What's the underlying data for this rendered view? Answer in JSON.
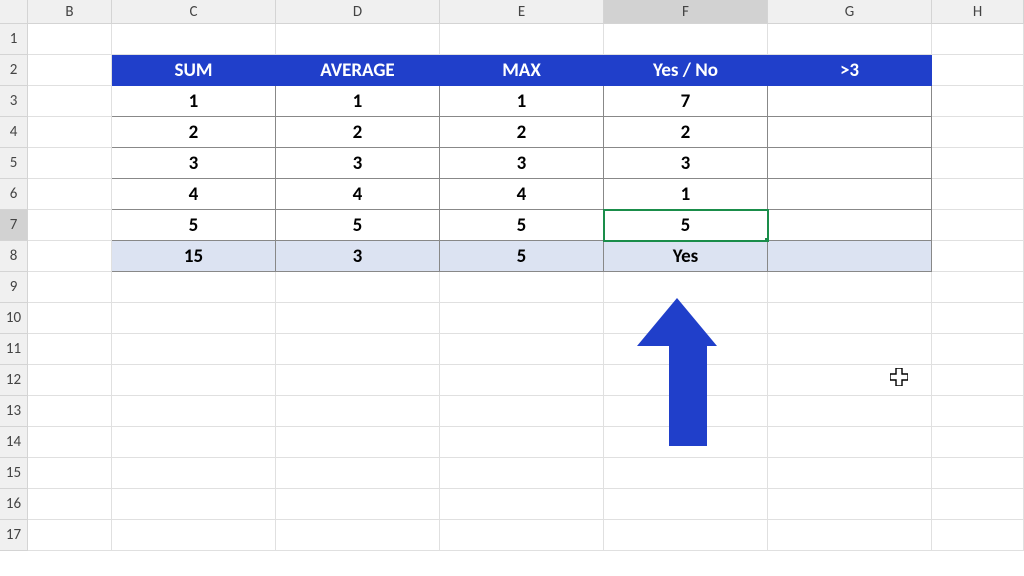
{
  "columns": [
    "B",
    "C",
    "D",
    "E",
    "F",
    "G",
    "H"
  ],
  "rows": [
    "1",
    "2",
    "3",
    "4",
    "5",
    "6",
    "7",
    "8",
    "9",
    "10",
    "11",
    "12",
    "13",
    "14",
    "15",
    "16",
    "17"
  ],
  "selected_col": "F",
  "selected_row": "7",
  "table": {
    "headers": {
      "c": "SUM",
      "d": "AVERAGE",
      "e": "MAX",
      "f": "Yes / No",
      "g": ">3"
    },
    "data": [
      {
        "c": "1",
        "d": "1",
        "e": "1",
        "f": "7",
        "g": ""
      },
      {
        "c": "2",
        "d": "2",
        "e": "2",
        "f": "2",
        "g": ""
      },
      {
        "c": "3",
        "d": "3",
        "e": "3",
        "f": "3",
        "g": ""
      },
      {
        "c": "4",
        "d": "4",
        "e": "4",
        "f": "1",
        "g": ""
      },
      {
        "c": "5",
        "d": "5",
        "e": "5",
        "f": "5",
        "g": ""
      }
    ],
    "result": {
      "c": "15",
      "d": "3",
      "e": "5",
      "f": "Yes",
      "g": ""
    }
  },
  "chart_data": {
    "type": "table",
    "title": "",
    "columns": [
      "SUM",
      "AVERAGE",
      "MAX",
      "Yes / No",
      ">3"
    ],
    "rows": [
      [
        1,
        1,
        1,
        7,
        null
      ],
      [
        2,
        2,
        2,
        2,
        null
      ],
      [
        3,
        3,
        3,
        3,
        null
      ],
      [
        4,
        4,
        4,
        1,
        null
      ],
      [
        5,
        5,
        5,
        5,
        null
      ]
    ],
    "summary": [
      15,
      3,
      5,
      "Yes",
      null
    ]
  }
}
